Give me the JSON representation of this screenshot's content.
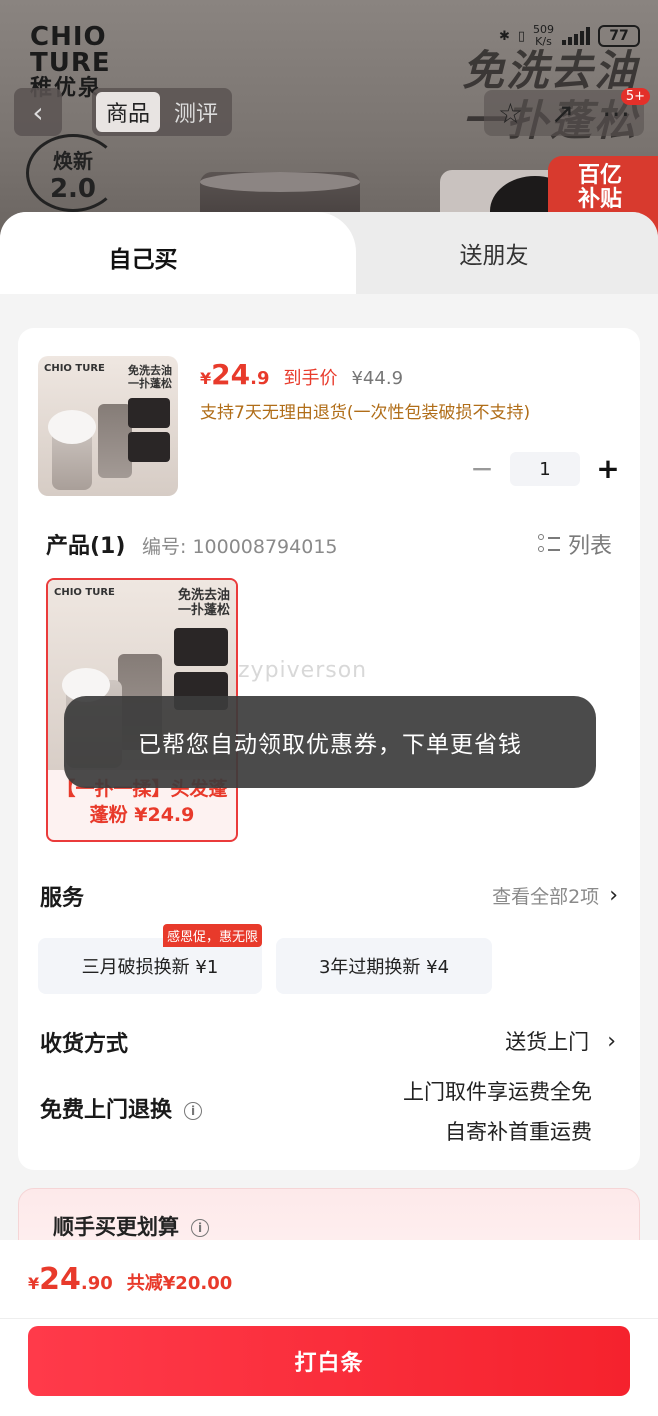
{
  "background": {
    "brand_lines": [
      "CHIO",
      "TURE",
      "稚优泉"
    ],
    "slogan_lines": [
      "免洗去油",
      "一扑蓬松"
    ],
    "renew_badge": {
      "top": "焕新",
      "bottom": "2.0"
    },
    "subsidy_lines": [
      "百亿",
      "补贴"
    ],
    "status": {
      "net_speed": "509",
      "net_unit": "K/s",
      "battery": "77"
    },
    "nav": {
      "back_icon": "chevron-left-icon",
      "tabs": [
        {
          "label": "商品",
          "active": true
        },
        {
          "label": "测评",
          "active": false
        }
      ],
      "actions": [
        "star-icon",
        "share-icon",
        "more-icon"
      ],
      "badge": "5+"
    }
  },
  "sheet": {
    "tabs": {
      "buy_self": "自己买",
      "gift_friend": "送朋友"
    },
    "product": {
      "thumb_brand": "CHIO TURE",
      "thumb_slogan": [
        "免洗去油",
        "一扑蓬松"
      ],
      "price": {
        "currency": "¥",
        "int": "24",
        "dec": ".9",
        "tag": "到手价",
        "original": "¥44.9"
      },
      "return_note": "支持7天无理由退货(一次性包装破损不支持)",
      "quantity": "1",
      "minus": "−",
      "plus": "+"
    },
    "sku_section": {
      "title": "产品(1)",
      "code_label": "编号: 100008794015",
      "list_toggle": "列表",
      "sku_name": "【一扑一揉】头发蓬蓬粉 ¥24.9"
    },
    "toast": "已帮您自动领取优惠券，下单更省钱",
    "watermark": "zypiverson",
    "services": {
      "title": "服务",
      "view_all": "查看全部2项",
      "items": [
        {
          "label": "三月破损换新  ¥1",
          "badge": "感恩促，惠无限"
        },
        {
          "label": "3年过期换新  ¥4",
          "badge": ""
        }
      ]
    },
    "delivery": {
      "title": "收货方式",
      "value": "送货上门"
    },
    "free_return": {
      "title": "免费上门退换",
      "lines": [
        "上门取件享运费全免",
        "自寄补首重运费"
      ]
    },
    "deals": {
      "title": "顺手买更划算"
    }
  },
  "bottom_bar": {
    "price": {
      "currency": "¥",
      "int": "24",
      "dec": ".90",
      "save": "共减¥20.00"
    },
    "pay_button": "打白条"
  },
  "colors": {
    "accent": "#e83a2b",
    "return_note": "#b06d18",
    "pay_button": "#f5222d"
  }
}
